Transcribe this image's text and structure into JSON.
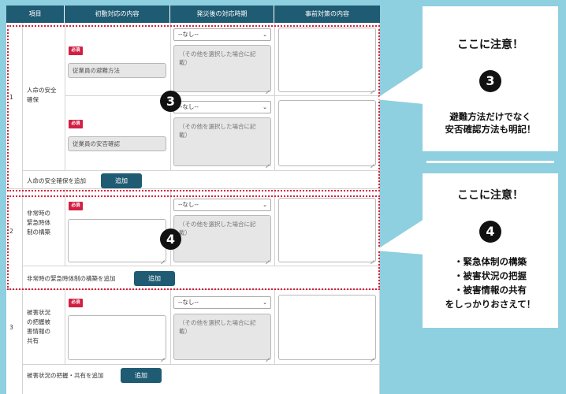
{
  "table": {
    "headers": [
      "項目",
      "初動対応の内容",
      "発災後の対応時期",
      "事前対策の内容"
    ],
    "required_badge": "必須",
    "select_value": "--なし--",
    "other_placeholder": "（その他を選択した場合に記載）",
    "add_button_label": "追加",
    "rows": [
      {
        "number": "1",
        "item": "人命の安全確保",
        "sub": [
          "従業員の避難方法",
          "従業員の安否確認"
        ],
        "add_label": "人命の安全確保を追加"
      },
      {
        "number": "2",
        "item": "非常時の緊急時体制の構築",
        "add_label": "非常時の緊急時体制の構築を追加"
      },
      {
        "number": "3",
        "item": "被害状況の把握被害情報の共有",
        "add_label": "被害状況の把握・共有を追加"
      }
    ]
  },
  "markers": [
    "3",
    "4"
  ],
  "callouts": {
    "c3": {
      "heading": "ここに注意！",
      "number": "3",
      "body": [
        "避難方法だけでなく",
        "安否確認方法も明記！"
      ]
    },
    "c4": {
      "heading": "ここに注意！",
      "number": "4",
      "body": [
        "・緊急体制の構築",
        "・被害状況の把握",
        "・被害情報の共有",
        "をしっかりおさえて！"
      ]
    }
  },
  "colors": {
    "header_bg": "#1f5b72",
    "accent_red": "#d21f43",
    "background": "#8ecfe0"
  }
}
